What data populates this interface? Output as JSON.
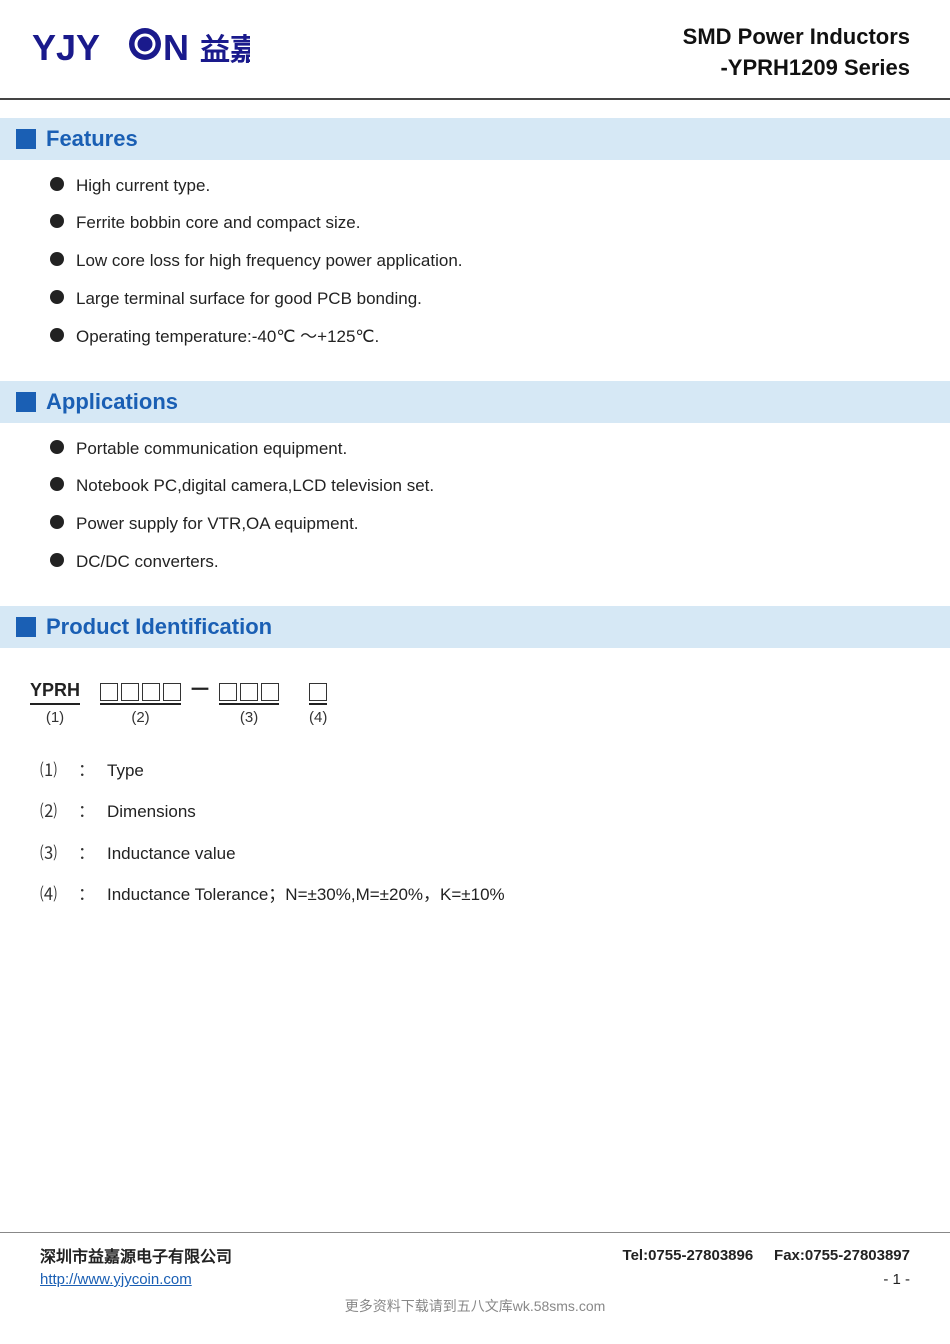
{
  "header": {
    "logo_text": "YJYCOIN",
    "logo_cn": "益嘉源",
    "title_line1": "SMD Power Inductors",
    "title_line2": "-YPRH1209 Series"
  },
  "sections": {
    "features": {
      "title": "Features",
      "items": [
        "High current type.",
        "Ferrite bobbin core and compact size.",
        "Low core loss for high frequency power application.",
        "Large terminal surface for good PCB bonding.",
        "Operating temperature:-40℃ ～+125℃."
      ]
    },
    "applications": {
      "title": "Applications",
      "items": [
        "Portable communication equipment.",
        "Notebook PC,digital camera,LCD television set.",
        "Power supply for VTR,OA equipment.",
        "DC/DC converters."
      ]
    },
    "product_identification": {
      "title": "Product Identification",
      "code_prefix": "YPRH",
      "code_prefix_label": "(1)",
      "group2_boxes": 4,
      "group2_label": "(2)",
      "group3_boxes": 3,
      "group3_label": "(3)",
      "group4_boxes": 1,
      "group4_label": "(4)",
      "items": [
        {
          "num": "⑴",
          "colon": "：",
          "text": "Type"
        },
        {
          "num": "⑵",
          "colon": "：",
          "text": "Dimensions"
        },
        {
          "num": "⑶",
          "colon": "：",
          "text": "Inductance value"
        },
        {
          "num": "⑷",
          "colon": "：",
          "text": "Inductance Tolerance；N=±30%,M=±20%，K=±10%"
        }
      ]
    }
  },
  "footer": {
    "company": "深圳市益嘉源电子有限公司",
    "tel": "Tel:0755-27803896",
    "fax": "Fax:0755-27803897",
    "website": "http://www.yjycoin.com",
    "page": "- 1 -",
    "watermark": "更多资料下载请到五八文库wk.58sms.com"
  }
}
